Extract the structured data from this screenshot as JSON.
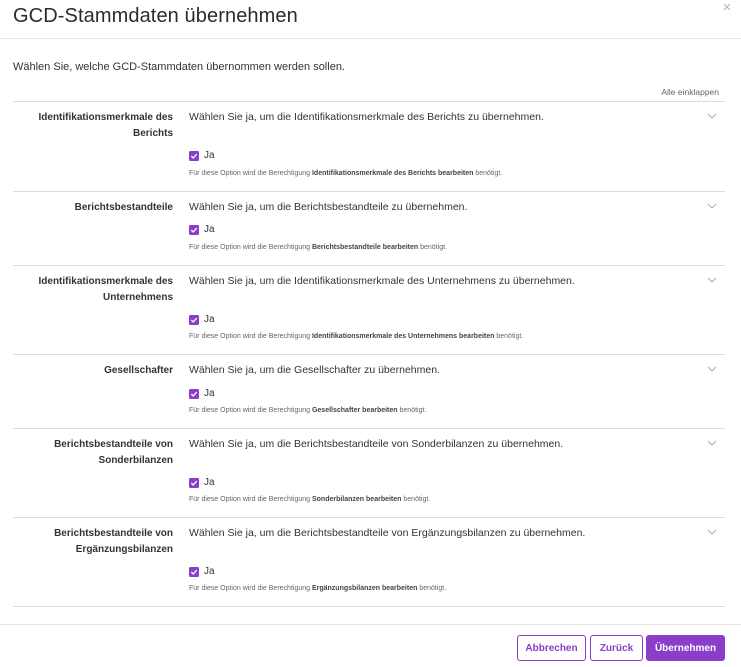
{
  "dialog": {
    "title": "GCD-Stammdaten übernehmen",
    "intro": "Wählen Sie, welche GCD-Stammdaten übernommen werden sollen.",
    "collapse_all": "Alle einklappen"
  },
  "sections": [
    {
      "label": "Identifikationsmerkmale des Berichts",
      "description": "Wählen Sie ja, um die Identifikationsmerkmale des Berichts zu übernehmen.",
      "checkbox_label": "Ja",
      "checked": true,
      "perm_prefix": "Für diese Option wird die Berechtigung",
      "perm_name": "Identifikationsmerkmale des Berichts bearbeiten",
      "perm_suffix": "benötigt."
    },
    {
      "label": "Berichtsbestandteile",
      "description": "Wählen Sie ja, um die Berichtsbestandteile zu übernehmen.",
      "checkbox_label": "Ja",
      "checked": true,
      "perm_prefix": "Für diese Option wird die Berechtigung",
      "perm_name": "Berichtsbestandteile bearbeiten",
      "perm_suffix": "benötigt."
    },
    {
      "label": "Identifikationsmerkmale des Unternehmens",
      "description": "Wählen Sie ja, um die Identifikationsmerkmale des Unternehmens zu übernehmen.",
      "checkbox_label": "Ja",
      "checked": true,
      "perm_prefix": "Für diese Option wird die Berechtigung",
      "perm_name": "Identifikationsmerkmale des Unternehmens bearbeiten",
      "perm_suffix": "benötigt."
    },
    {
      "label": "Gesellschafter",
      "description": "Wählen Sie ja, um die Gesellschafter zu übernehmen.",
      "checkbox_label": "Ja",
      "checked": true,
      "perm_prefix": "Für diese Option wird die Berechtigung",
      "perm_name": "Gesellschafter bearbeiten",
      "perm_suffix": "benötigt."
    },
    {
      "label": "Berichtsbestandteile von Sonderbilanzen",
      "description": "Wählen Sie ja, um die Berichtsbestandteile von Sonderbilanzen zu übernehmen.",
      "checkbox_label": "Ja",
      "checked": true,
      "perm_prefix": "Für diese Option wird die Berechtigung",
      "perm_name": "Sonderbilanzen bearbeiten",
      "perm_suffix": "benötigt."
    },
    {
      "label": "Berichtsbestandteile von Ergänzungsbilanzen",
      "description": "Wählen Sie ja, um die Berichtsbestandteile von Ergänzungsbilanzen zu übernehmen.",
      "checkbox_label": "Ja",
      "checked": true,
      "perm_prefix": "Für diese Option wird die Berechtigung",
      "perm_name": "Ergänzungsbilanzen bearbeiten",
      "perm_suffix": "benötigt."
    }
  ],
  "footer": {
    "cancel": "Abbrechen",
    "back": "Zurück",
    "apply": "Übernehmen"
  },
  "icons": {
    "close": "close-icon",
    "chevron": "chevron-down-icon",
    "check": "checkmark-icon"
  },
  "colors": {
    "accent": "#8a3ec9"
  }
}
